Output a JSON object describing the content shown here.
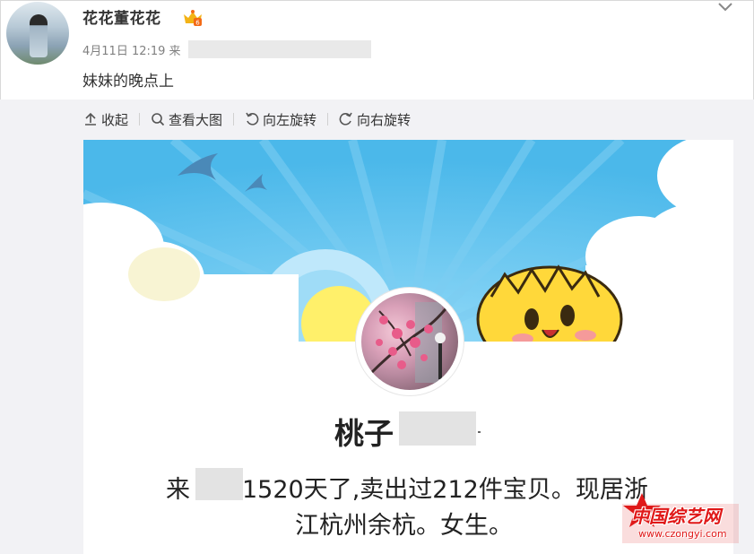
{
  "post": {
    "username": "花花董花花",
    "timestamp": "4月11日 12:19 来",
    "text": "妹妹的晚点上",
    "icons": {
      "avatar": "user-avatar",
      "vip": "crown-badge-icon",
      "menu": "chevron-down-icon"
    }
  },
  "toolbar": {
    "collapse": "收起",
    "view_large": "查看大图",
    "rotate_left": "向左旋转",
    "rotate_right": "向右旋转"
  },
  "image": {
    "shop_name": "桃子",
    "desc_prefix": "来",
    "desc_line1_rest": "1520天了,卖出过212件宝贝。现居浙",
    "desc_line2": "江杭州余杭。女生。"
  },
  "watermark": {
    "title": "中国综艺网",
    "url": "www.czongyi.com"
  },
  "colors": {
    "sky": "#5ec2ef",
    "sun": "#fff06a",
    "cloud": "#ffffff",
    "watermark_red": "#e01818"
  }
}
